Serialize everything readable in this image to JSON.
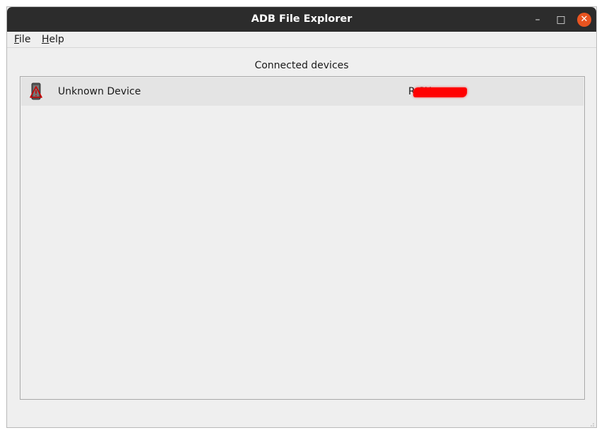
{
  "window": {
    "title": "ADB File Explorer",
    "minimize_glyph": "–",
    "maximize_glyph": "□",
    "close_glyph": "✕"
  },
  "menu": {
    "file_mnemonic": "F",
    "file_rest": "ile",
    "help_mnemonic": "H",
    "help_rest": "elp"
  },
  "main": {
    "heading": "Connected devices",
    "devices": [
      {
        "name": "Unknown Device",
        "serial": "R                SX",
        "icon": "phone-warning-icon",
        "serial_redacted": true
      }
    ]
  },
  "colors": {
    "titlebar": "#2c2c2c",
    "close_button": "#e95420",
    "window_bg": "#efefef",
    "selected_row": "#e4e4e4",
    "redaction": "#ff0000",
    "icon_warning": "#cc0000"
  }
}
